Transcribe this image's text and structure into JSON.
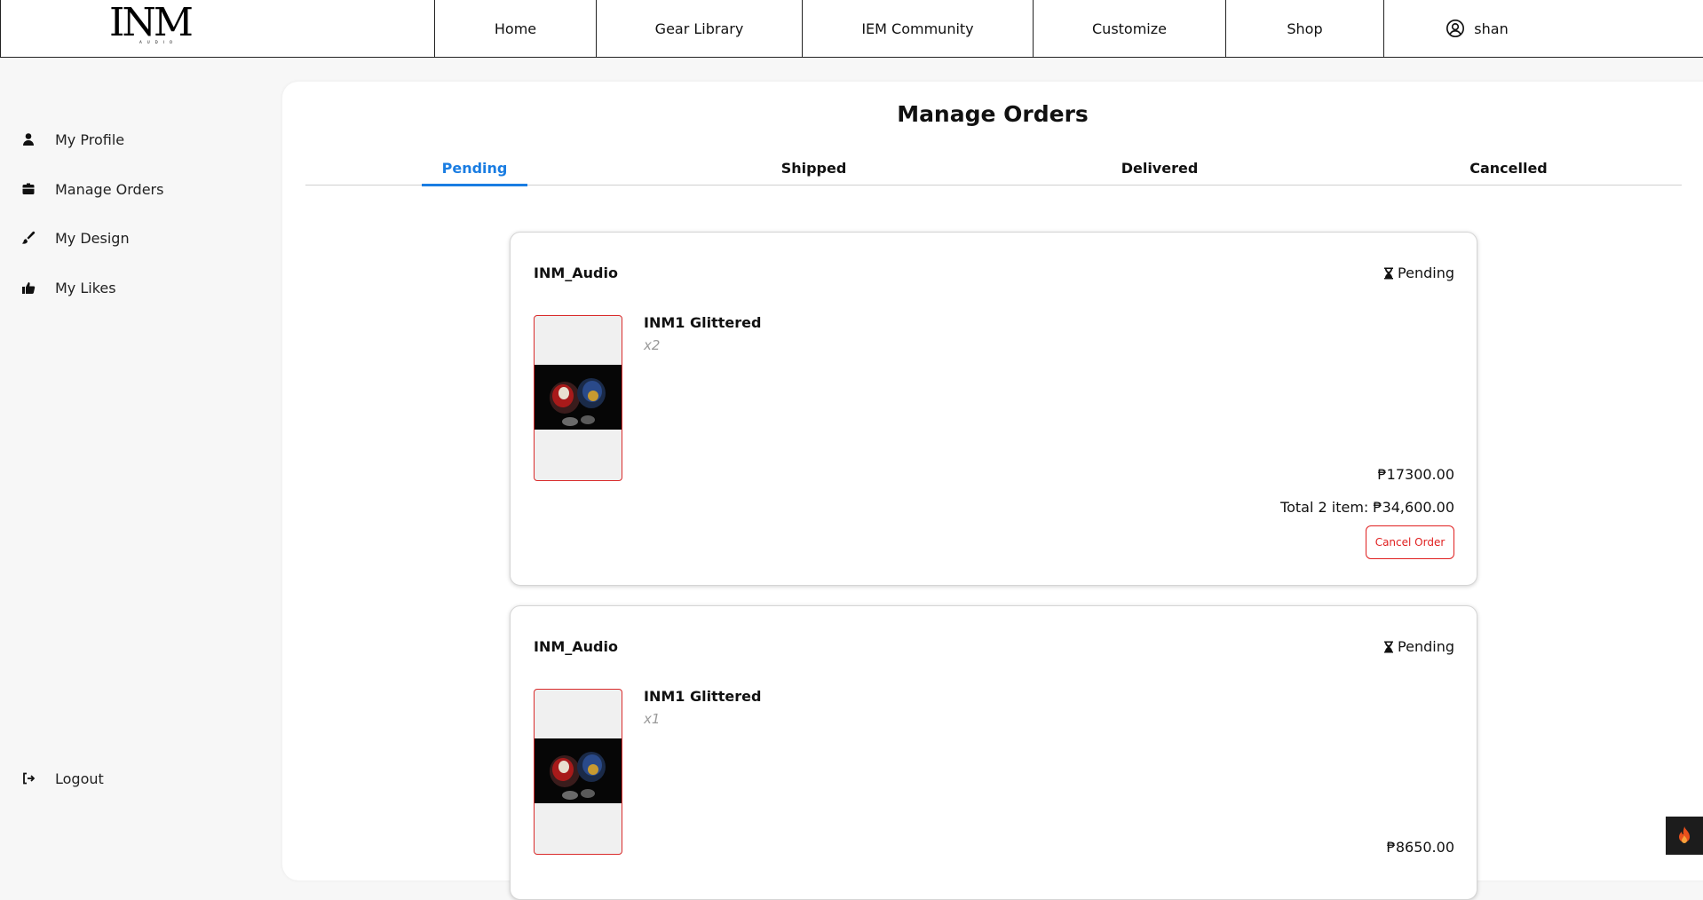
{
  "brand": {
    "logo_text": "INM",
    "logo_sub": "AUDIO"
  },
  "nav": {
    "items": [
      {
        "label": "Home"
      },
      {
        "label": "Gear Library"
      },
      {
        "label": "IEM Community"
      },
      {
        "label": "Customize"
      },
      {
        "label": "Shop"
      }
    ],
    "user": {
      "name": "shan",
      "icon": "user-circle-icon"
    }
  },
  "sidebar": {
    "items": [
      {
        "label": "My Profile",
        "icon": "user-icon"
      },
      {
        "label": "Manage Orders",
        "icon": "box-icon"
      },
      {
        "label": "My Design",
        "icon": "brush-icon"
      },
      {
        "label": "My Likes",
        "icon": "thumbs-up-icon"
      }
    ],
    "logout": {
      "label": "Logout",
      "icon": "logout-icon"
    }
  },
  "main": {
    "title": "Manage Orders",
    "tabs": [
      {
        "label": "Pending",
        "active": true
      },
      {
        "label": "Shipped",
        "active": false
      },
      {
        "label": "Delivered",
        "active": false
      },
      {
        "label": "Cancelled",
        "active": false
      }
    ],
    "orders": [
      {
        "shop": "INM_Audio",
        "status": "Pending",
        "status_icon": "hourglass-icon",
        "product": "INM1 Glittered",
        "qty": "x2",
        "price": "₱17300.00",
        "total": "Total 2 item: ₱34,600.00",
        "cancel_label": "Cancel Order"
      },
      {
        "shop": "INM_Audio",
        "status": "Pending",
        "status_icon": "hourglass-icon",
        "product": "INM1 Glittered",
        "qty": "x1",
        "price": "₱8650.00"
      }
    ]
  },
  "colors": {
    "accent": "#1a7de2",
    "danger": "#e02020",
    "background": "#f7f7f7"
  }
}
